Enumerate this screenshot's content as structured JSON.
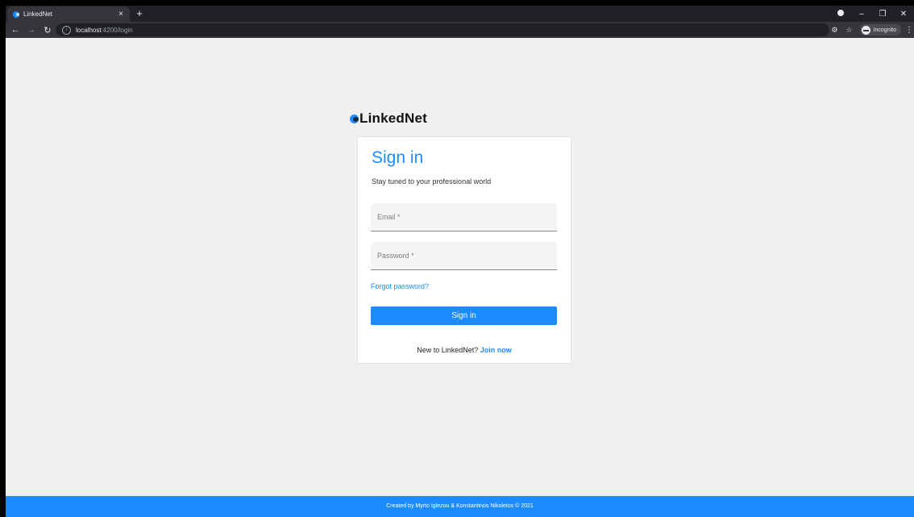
{
  "browser": {
    "tab_title": "LinkedNet",
    "tab_close": "×",
    "new_tab": "+",
    "url_host": "localhost",
    "url_path": ":4200/login",
    "incognito_label": "Incognito"
  },
  "page": {
    "logo_text": "LinkedNet",
    "title": "Sign in",
    "subtitle": "Stay tuned to your professional world",
    "email_placeholder": "Email *",
    "password_placeholder": "Password *",
    "forgot_password": "Forgot password?",
    "signin_button": "Sign in",
    "new_prompt": "New to LinkedNet?",
    "join_now": "Join now"
  },
  "footer": {
    "text": "Created by Myrto Iglezou & Konstantinos Nikoletos © 2021"
  },
  "colors": {
    "accent": "#1a8cff",
    "background": "#f0f0f0",
    "chrome_dark": "#202124",
    "chrome_toolbar": "#35363a"
  },
  "icons": {
    "back": "arrow-left-icon",
    "forward": "arrow-right-icon",
    "reload": "reload-icon",
    "site_info": "info-icon",
    "key": "key-icon",
    "bookmark": "star-icon",
    "incognito": "incognito-icon",
    "menu": "kebab-menu-icon"
  }
}
